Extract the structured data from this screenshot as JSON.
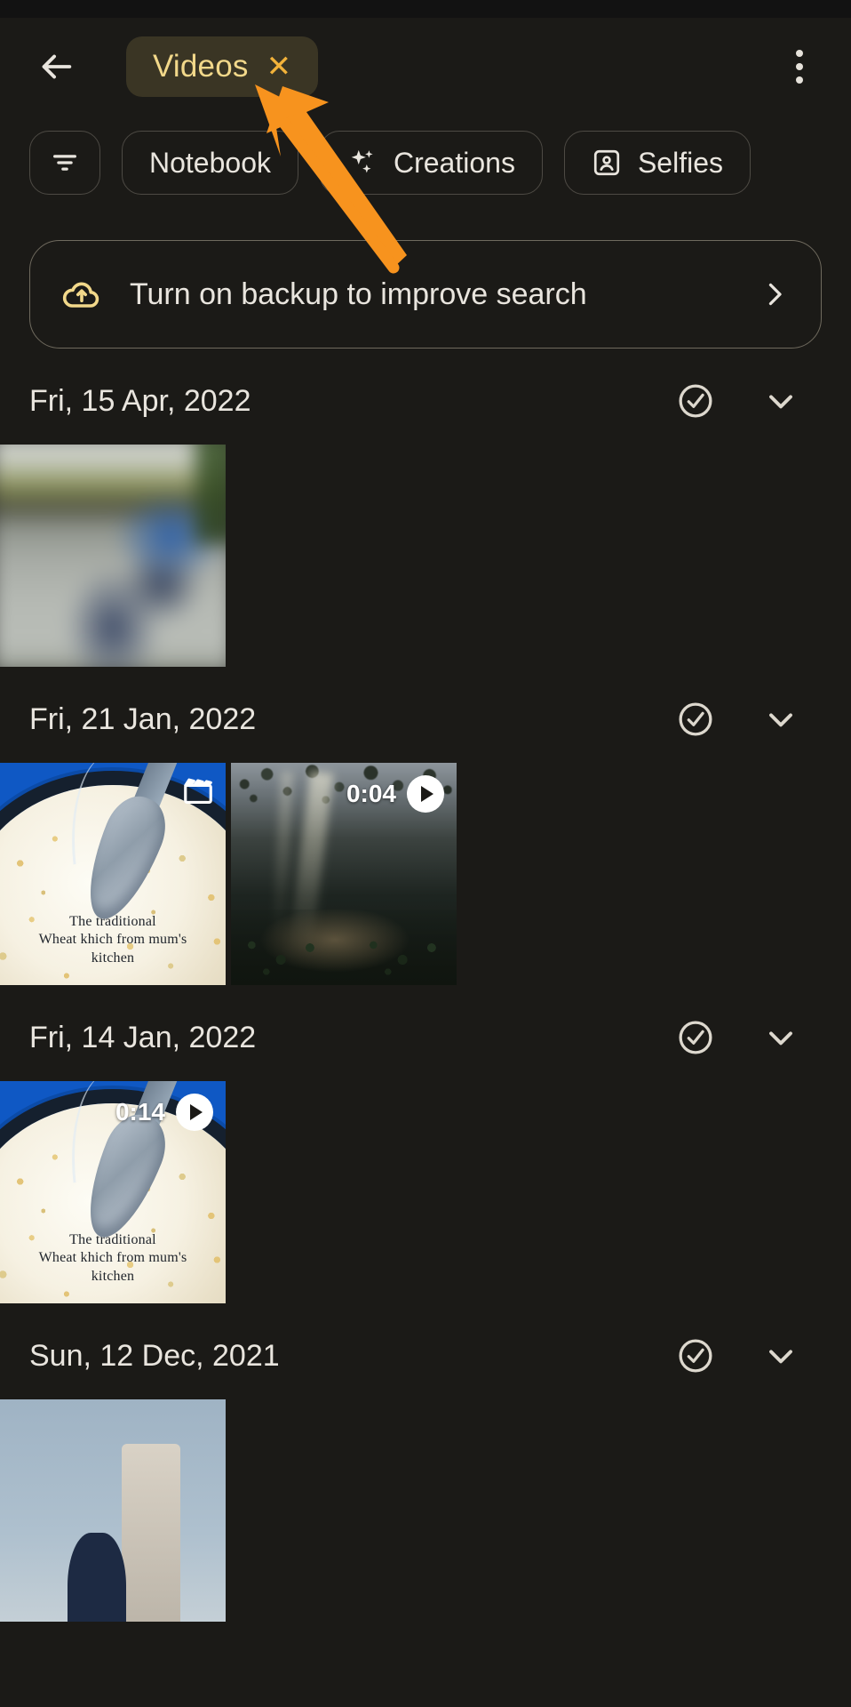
{
  "app": {
    "theme_bg": "#1b1a17",
    "accent": "#f2d88a",
    "annotation_color": "#f7931e"
  },
  "appbar": {
    "back_icon": "arrow-left-icon",
    "query_chip": {
      "label": "Videos",
      "close_glyph": "✕"
    },
    "overflow_icon": "more-vert-icon"
  },
  "chips": [
    {
      "name": "filters",
      "label": "",
      "icon": "filter-list-icon",
      "icon_only": true
    },
    {
      "name": "notebook",
      "label": "Notebook",
      "icon": ""
    },
    {
      "name": "creations",
      "label": "Creations",
      "icon": "sparkle-icon"
    },
    {
      "name": "selfies",
      "label": "Selfies",
      "icon": "portrait-id-icon"
    }
  ],
  "banner": {
    "icon": "cloud-upload-icon",
    "text": "Turn on backup to improve search",
    "chevron": "chevron-right-icon"
  },
  "sections": [
    {
      "date": "Fri, 15 Apr, 2022",
      "select_icon": "check-circle-icon",
      "expand_icon": "chevron-down-icon",
      "items": [
        {
          "art": "blur",
          "duration": "",
          "has_play": false,
          "has_clapper": false,
          "caption": ""
        }
      ]
    },
    {
      "date": "Fri, 21 Jan, 2022",
      "select_icon": "check-circle-icon",
      "expand_icon": "chevron-down-icon",
      "items": [
        {
          "art": "food",
          "duration": "",
          "has_play": false,
          "has_clapper": true,
          "caption": "The traditional\nWheat khich from mum's\nkitchen"
        },
        {
          "art": "forest",
          "duration": "0:04",
          "has_play": true,
          "has_clapper": false,
          "caption": ""
        }
      ]
    },
    {
      "date": "Fri, 14 Jan, 2022",
      "select_icon": "check-circle-icon",
      "expand_icon": "chevron-down-icon",
      "items": [
        {
          "art": "food",
          "duration": "0:14",
          "has_play": true,
          "has_clapper": false,
          "caption": "The traditional\nWheat khich from mum's\nkitchen"
        }
      ]
    },
    {
      "date": "Sun, 12 Dec, 2021",
      "select_icon": "check-circle-icon",
      "expand_icon": "chevron-down-icon",
      "items": [
        {
          "art": "sky",
          "duration": "",
          "has_play": false,
          "has_clapper": false,
          "caption": ""
        }
      ]
    }
  ],
  "annotation": {
    "type": "arrow",
    "points_to": "query-chip",
    "color": "#f7931e"
  }
}
